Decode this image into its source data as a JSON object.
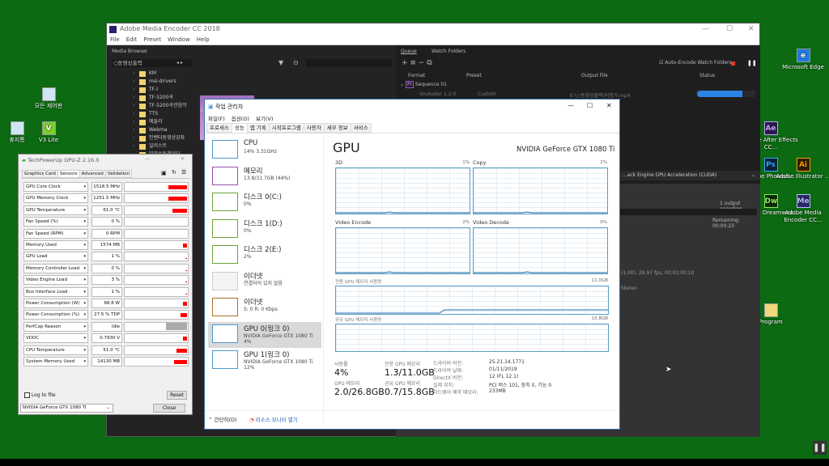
{
  "desktop": {
    "icons": [
      {
        "label": "모든 제어판",
        "icon": "control-panel-icon"
      },
      {
        "label": "휴지통",
        "icon": "recycle-bin-icon"
      },
      {
        "label": "V3 Lite",
        "icon": "v3-icon"
      },
      {
        "label": "Microsoft Edge",
        "icon": "edge-icon",
        "glyph": "e",
        "color": "#1f7be0"
      },
      {
        "label": "Adobe After Effects CC...",
        "glyph": "Ae",
        "color": "#2a1a4e",
        "fg": "#c9a2ff"
      },
      {
        "label": "Adobe Photosh...",
        "glyph": "Ps",
        "color": "#0b2238",
        "fg": "#31a8ff"
      },
      {
        "label": "Adobe Illustrator ...",
        "glyph": "Ai",
        "color": "#331c00",
        "fg": "#ff9a00"
      },
      {
        "label": "Adobe Dreamwea...",
        "glyph": "Dw",
        "color": "#0f2a0a",
        "fg": "#8cf25c"
      },
      {
        "label": "Adobe Media Encoder CC...",
        "glyph": "Me",
        "color": "#2a2a6e",
        "fg": "#bcbcff"
      },
      {
        "label": "Program",
        "icon": "folder-icon"
      }
    ]
  },
  "media_encoder": {
    "title": "Adobe Media Encoder CC 2018",
    "menu": [
      "File",
      "Edit",
      "Preset",
      "Window",
      "Help"
    ],
    "media_browser_label": "Media Browser",
    "location": "○동영상출력",
    "folders": [
      "KM",
      "msi-drivers",
      "TF-I",
      "TF-5200곡",
      "TF-5200곡관음악",
      "TTS",
      "메들리",
      "Webma",
      "인벤터동영상강좌",
      "일러스트",
      "일러스트레이터"
    ],
    "thumb_label": "D",
    "queue_tab": "Queue",
    "watch_tab": "Watch Folders",
    "auto_encode": "Auto-Encode Watch Folders",
    "columns": [
      "Format",
      "Preset",
      "Output File",
      "Status"
    ],
    "sequence": "Sequence 01",
    "item": {
      "format": "Voukoder 1.2.0",
      "preset": "Custom",
      "output": "E:\\○동영상출력\\비명가.mp4",
      "progress": 0.78
    },
    "renderer": "...ack Engine GPU Acceleration (CUDA)",
    "encoding_count": "1 output encoding",
    "encoding_progress": 0.5,
    "remaining": "Remaining: 00:00:23",
    "video_info": "(1.00), 29.97 fps, 00;03;00;10",
    "audio_info": "Stereo"
  },
  "task_manager": {
    "title": "작업 관리자",
    "menu": [
      "파일(F)",
      "옵션(O)",
      "보기(V)"
    ],
    "tabs": [
      "프로세스",
      "성능",
      "앱 기록",
      "시작프로그램",
      "사용자",
      "세부 정보",
      "서비스"
    ],
    "active_tab": 1,
    "sidebar": [
      {
        "name": "CPU",
        "sub": "14% 3.31GHz",
        "color": "#4a9bc9"
      },
      {
        "name": "메모리",
        "sub": "13.8/31.7GB (44%)",
        "color": "#9b4fb0"
      },
      {
        "name": "디스크 0(C:)",
        "sub": "0%",
        "color": "#6ba53a"
      },
      {
        "name": "디스크 1(D:)",
        "sub": "0%",
        "color": "#6ba53a"
      },
      {
        "name": "디스크 2(E:)",
        "sub": "2%",
        "color": "#6ba53a"
      },
      {
        "name": "이더넷",
        "sub": "연결되어 있지 않음",
        "color": "#cccccc"
      },
      {
        "name": "이더넷",
        "sub": "S: 0 R: 0 Kbps",
        "color": "#a7722a"
      },
      {
        "name": "GPU 0(링크 0)",
        "sub": "NVIDIA GeForce GTX 1080 Ti",
        "sub2": "4%",
        "color": "#4a9bc9"
      },
      {
        "name": "GPU 1(링크 0)",
        "sub": "NVIDIA GeForce GTX 1080 Ti",
        "sub2": "12%",
        "color": "#4a9bc9"
      }
    ],
    "selected": 7,
    "heading": "GPU",
    "gpu_name": "NVIDIA GeForce GTX 1080 Ti",
    "engines": [
      {
        "label": "3D",
        "value": "1%"
      },
      {
        "label": "Copy",
        "value": "2%"
      },
      {
        "label": "Video Encode",
        "value": "2%"
      },
      {
        "label": "Video Decode",
        "value": "0%"
      }
    ],
    "dedicated_label": "전용 GPU 메모리 사용량",
    "dedicated_max": "11.0GB",
    "shared_label": "공유 GPU 메모리 사용량",
    "shared_max": "15.8GB",
    "stats": [
      {
        "label": "사용률",
        "value": "4%"
      },
      {
        "label": "전용 GPU 메모리",
        "value": "1.3/11.0GB"
      },
      {
        "label": "GPU 메모리",
        "value": "2.0/26.8GB"
      },
      {
        "label": "공유 GPU 메모리",
        "value": "0.7/15.8GB"
      }
    ],
    "details": [
      {
        "k": "드라이버 버전:",
        "v": "25.21.14.1771"
      },
      {
        "k": "드라이버 날짜:",
        "v": "01/11/2019"
      },
      {
        "k": "DirectX 버전:",
        "v": "12 (FL 12.1)"
      },
      {
        "k": "실제 위치:",
        "v": "PCI 버스 101, 장치 0, 기능 0"
      },
      {
        "k": "하드웨어 예약 메모리:",
        "v": "233MB"
      }
    ],
    "fewer_details": "간단히(D)",
    "resource_monitor": "리소스 모니터 열기"
  },
  "gpuz": {
    "title": "TechPowerUp GPU-Z 2.16.0",
    "tabs": [
      "Graphics Card",
      "Sensors",
      "Advanced",
      "Validation"
    ],
    "active_tab": 1,
    "sensors": [
      {
        "name": "GPU Core Clock",
        "value": "1518.5 MHz",
        "level": 0.9
      },
      {
        "name": "GPU Memory Clock",
        "value": "1251.5 MHz",
        "level": 0.9
      },
      {
        "name": "GPU Temperature",
        "value": "61.0 °C",
        "level": 0.7
      },
      {
        "name": "Fan Speed (%)",
        "value": "0 %",
        "level": 0
      },
      {
        "name": "Fan Speed (RPM)",
        "value": "0 RPM",
        "level": 0
      },
      {
        "name": "Memory Used",
        "value": "1574 MB",
        "level": 0.2
      },
      {
        "name": "GPU Load",
        "value": "1 %",
        "level": 0.05
      },
      {
        "name": "Memory Controller Load",
        "value": "0 %",
        "level": 0.02
      },
      {
        "name": "Video Engine Load",
        "value": "3 %",
        "level": 0.05
      },
      {
        "name": "Bus Interface Load",
        "value": "1 %",
        "level": 0.03
      },
      {
        "name": "Power Consumption (W)",
        "value": "68.8 W",
        "level": 0.2
      },
      {
        "name": "Power Consumption (%)",
        "value": "27.5 % TDP",
        "level": 0.3
      },
      {
        "name": "PerfCap Reason",
        "value": "Idle",
        "level": 1,
        "gray": true
      },
      {
        "name": "VDDC",
        "value": "0.7930 V",
        "level": 0.2
      },
      {
        "name": "CPU Temperature",
        "value": "51.0 °C",
        "level": 0.5
      },
      {
        "name": "System Memory Used",
        "value": "14130 MB",
        "level": 0.6
      }
    ],
    "log_to_file": "Log to file",
    "reset": "Reset",
    "device": "NVIDIA GeForce GTX 1080 Ti",
    "close": "Close"
  }
}
